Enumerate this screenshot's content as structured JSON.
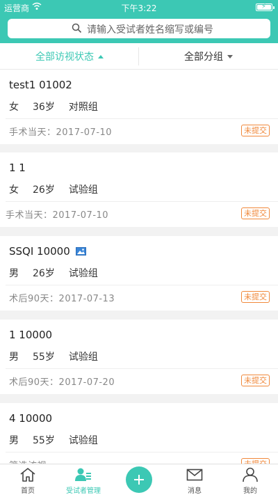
{
  "status_bar": {
    "carrier": "运营商",
    "time": "下午3:22",
    "battery_level": 1.0
  },
  "search": {
    "placeholder": "请输入受试者姓名缩写或编号"
  },
  "filters": {
    "visit_status": "全部访视状态",
    "group": "全部分组"
  },
  "subjects": [
    {
      "name": "test1  01002",
      "gender": "女",
      "age": "36岁",
      "group": "对照组",
      "date_label": "手术当天：2017-07-10",
      "status": "未提交",
      "has_image": false
    },
    {
      "name": "1 1",
      "gender": "女",
      "age": "26岁",
      "group": "试验组",
      "date_label": "手术当天：2017-07-10",
      "status": "未提交",
      "has_image": false
    },
    {
      "name": "SSQI  10000",
      "gender": "男",
      "age": "26岁",
      "group": "试验组",
      "date_label": "术后90天：2017-07-13",
      "status": "未提交",
      "has_image": true
    },
    {
      "name": "1  10000",
      "gender": "男",
      "age": "55岁",
      "group": "试验组",
      "date_label": "术后90天：2017-07-20",
      "status": "未提交",
      "has_image": false
    },
    {
      "name": "4  10000",
      "gender": "男",
      "age": "55岁",
      "group": "试验组",
      "date_label": "筛选访视",
      "status": "未提交",
      "has_image": false
    }
  ],
  "tabbar": {
    "items": [
      {
        "label": "首页",
        "icon": "home-icon"
      },
      {
        "label": "受试者管理",
        "icon": "subject-manage-icon"
      },
      {
        "label": "",
        "icon": "plus-icon"
      },
      {
        "label": "消息",
        "icon": "mail-icon"
      },
      {
        "label": "我的",
        "icon": "person-icon"
      }
    ],
    "active_index": 1
  },
  "colors": {
    "accent": "#3cc8b4",
    "badge": "#f0883a"
  }
}
